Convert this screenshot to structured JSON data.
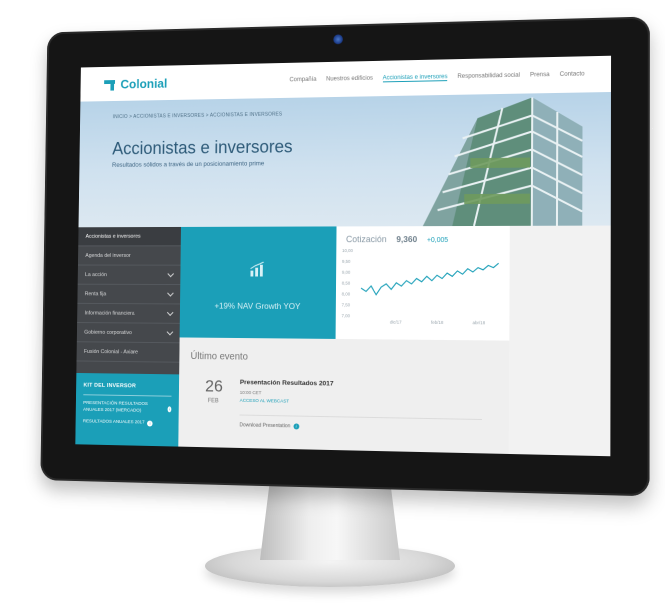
{
  "header": {
    "logo_text": "Colonial",
    "nav": [
      "Compañía",
      "Nuestros edificios",
      "Accionistas e inversores",
      "Responsabilidad social",
      "Prensa",
      "Contacto"
    ],
    "nav_active_index": 2
  },
  "hero": {
    "breadcrumb": "INICIO  >  ACCIONISTAS E INVERSORES  >  ACCIONISTAS E INVERSORES",
    "title": "Accionistas e inversores",
    "subtitle": "Resultados sólidos a través de un posicionamiento prime"
  },
  "sidebar": {
    "items": [
      {
        "label": "Accionistas e inversores",
        "has_chevron": false
      },
      {
        "label": "Agenda del inversor",
        "has_chevron": false
      },
      {
        "label": "La acción",
        "has_chevron": true
      },
      {
        "label": "Renta fija",
        "has_chevron": true
      },
      {
        "label": "Información financiera",
        "has_chevron": true
      },
      {
        "label": "Gobierno corporativo",
        "has_chevron": true
      },
      {
        "label": "Fusión Colonial - Axiare",
        "has_chevron": false
      }
    ],
    "kit": {
      "title": "KIT DEL INVERSOR",
      "links": [
        "PRESENTACIÓN RESULTADOS ANUALES 2017 (MERCADO)",
        "RESULTADOS ANUALES 2017"
      ]
    }
  },
  "highlight": {
    "text": "+19% NAV Growth YOY",
    "icon": "bar-chart-icon"
  },
  "quote": {
    "label": "Cotización",
    "price": "9,360",
    "change": "+0,005"
  },
  "chart_data": {
    "type": "line",
    "title": "",
    "y_ticks": [
      "10,00",
      "9,50",
      "9,00",
      "8,50",
      "8,00",
      "7,50",
      "7,00"
    ],
    "ylim": [
      7.0,
      10.0
    ],
    "x_ticks": [
      "dic/17",
      "feb/18",
      "abr/18"
    ],
    "series": [
      {
        "values": [
          8.25,
          8.1,
          8.35,
          7.95,
          8.3,
          8.45,
          8.2,
          8.5,
          8.35,
          8.6,
          8.45,
          8.7,
          8.55,
          8.8,
          8.6,
          8.85,
          8.7,
          8.95,
          8.8,
          9.05,
          8.9,
          9.15,
          9.0,
          9.2,
          9.1,
          9.3,
          9.2,
          9.4
        ]
      }
    ]
  },
  "events": {
    "heading": "Último evento",
    "day": "26",
    "month": "FEB",
    "title": "Presentación Resultados 2017",
    "time": "10:00 CET",
    "access_label": "ACCESO AL WEBCAST",
    "download_label": "Download Presentation"
  },
  "colors": {
    "accent": "#1b9fb8",
    "sidebar": "#45484c"
  }
}
